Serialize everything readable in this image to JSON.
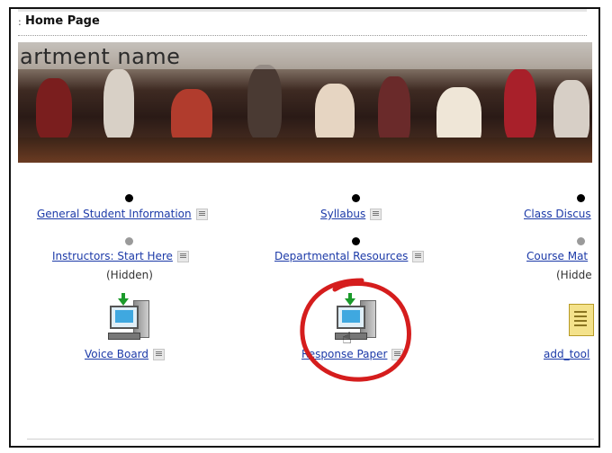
{
  "header": {
    "marker": ":",
    "title": "Home Page"
  },
  "banner": {
    "text": "artment name"
  },
  "tools": [
    {
      "label": "General Student Information",
      "bullet": "black"
    },
    {
      "label": "Syllabus",
      "bullet": "black"
    },
    {
      "label": "Class Discus",
      "bullet": "black"
    },
    {
      "label": "Instructors: Start Here",
      "bullet": "grey",
      "status": "(Hidden)"
    },
    {
      "label": "Departmental Resources",
      "bullet": "black"
    },
    {
      "label": "Course Mat",
      "bullet": "grey",
      "status": "(Hidde"
    },
    {
      "label": "Voice Board",
      "icon": "download-computer-icon"
    },
    {
      "label": "Response Paper",
      "icon": "download-computer-icon"
    },
    {
      "label": "add_tool",
      "icon": "document-icon"
    }
  ],
  "highlight": {
    "color": "#d51d1d"
  }
}
